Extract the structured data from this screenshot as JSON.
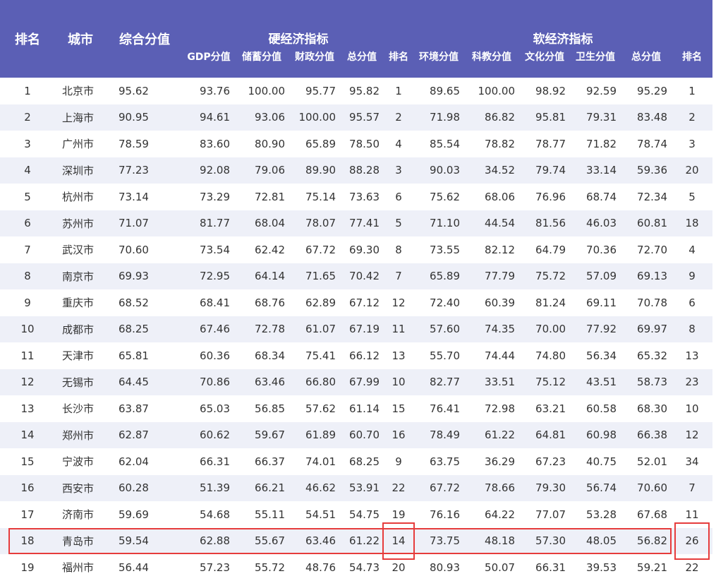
{
  "header": {
    "rank": "排名",
    "city": "城市",
    "composite": "综合分值",
    "hard_group": "硬经济指标",
    "soft_group": "软经济指标",
    "hard_cols": [
      "GDP分值",
      "储蓄分值",
      "财政分值",
      "总分值",
      "排名"
    ],
    "soft_cols": [
      "环境分值",
      "科教分值",
      "文化分值",
      "卫生分值",
      "总分值",
      "排名"
    ]
  },
  "rows": [
    [
      "1",
      "北京市",
      "95.62",
      "93.76",
      "100.00",
      "95.77",
      "95.82",
      "1",
      "89.65",
      "100.00",
      "98.92",
      "92.59",
      "95.29",
      "1"
    ],
    [
      "2",
      "上海市",
      "90.95",
      "94.61",
      "93.06",
      "100.00",
      "95.57",
      "2",
      "71.98",
      "86.82",
      "95.81",
      "79.31",
      "83.48",
      "2"
    ],
    [
      "3",
      "广州市",
      "78.59",
      "83.60",
      "80.90",
      "65.89",
      "78.50",
      "4",
      "85.54",
      "78.82",
      "78.77",
      "71.82",
      "78.74",
      "3"
    ],
    [
      "4",
      "深圳市",
      "77.23",
      "92.08",
      "79.06",
      "89.90",
      "88.28",
      "3",
      "90.03",
      "34.52",
      "79.74",
      "33.14",
      "59.36",
      "20"
    ],
    [
      "5",
      "杭州市",
      "73.14",
      "73.29",
      "72.81",
      "75.14",
      "73.63",
      "6",
      "75.62",
      "68.06",
      "76.96",
      "68.74",
      "72.34",
      "5"
    ],
    [
      "6",
      "苏州市",
      "71.07",
      "81.77",
      "68.04",
      "78.07",
      "77.41",
      "5",
      "71.10",
      "44.54",
      "81.56",
      "46.03",
      "60.81",
      "18"
    ],
    [
      "7",
      "武汉市",
      "70.60",
      "73.54",
      "62.42",
      "67.72",
      "69.30",
      "8",
      "73.55",
      "82.12",
      "64.79",
      "70.36",
      "72.70",
      "4"
    ],
    [
      "8",
      "南京市",
      "69.93",
      "72.95",
      "64.14",
      "71.65",
      "70.42",
      "7",
      "65.89",
      "77.79",
      "75.72",
      "57.09",
      "69.13",
      "9"
    ],
    [
      "9",
      "重庆市",
      "68.52",
      "68.41",
      "68.76",
      "62.89",
      "67.12",
      "12",
      "72.40",
      "60.39",
      "81.24",
      "69.11",
      "70.78",
      "6"
    ],
    [
      "10",
      "成都市",
      "68.25",
      "67.46",
      "72.78",
      "61.07",
      "67.19",
      "11",
      "57.60",
      "74.35",
      "70.00",
      "77.92",
      "69.97",
      "8"
    ],
    [
      "11",
      "天津市",
      "65.81",
      "60.36",
      "68.34",
      "75.41",
      "66.12",
      "13",
      "55.70",
      "74.44",
      "74.80",
      "56.34",
      "65.32",
      "13"
    ],
    [
      "12",
      "无锡市",
      "64.45",
      "70.86",
      "63.46",
      "66.80",
      "67.99",
      "10",
      "82.77",
      "33.51",
      "75.12",
      "43.51",
      "58.73",
      "23"
    ],
    [
      "13",
      "长沙市",
      "63.87",
      "65.03",
      "56.85",
      "57.62",
      "61.14",
      "15",
      "76.41",
      "72.98",
      "63.21",
      "60.58",
      "68.30",
      "10"
    ],
    [
      "14",
      "郑州市",
      "62.87",
      "60.62",
      "59.67",
      "61.89",
      "60.70",
      "16",
      "78.49",
      "61.22",
      "64.81",
      "60.98",
      "66.38",
      "12"
    ],
    [
      "15",
      "宁波市",
      "62.04",
      "66.31",
      "66.37",
      "74.01",
      "68.25",
      "9",
      "63.75",
      "36.29",
      "67.23",
      "40.75",
      "52.01",
      "34"
    ],
    [
      "16",
      "西安市",
      "60.28",
      "51.39",
      "66.21",
      "46.62",
      "53.91",
      "22",
      "67.72",
      "78.66",
      "79.30",
      "56.74",
      "70.60",
      "7"
    ],
    [
      "17",
      "济南市",
      "59.69",
      "54.68",
      "55.11",
      "54.51",
      "54.75",
      "19",
      "76.16",
      "64.22",
      "77.07",
      "53.28",
      "67.68",
      "11"
    ],
    [
      "18",
      "青岛市",
      "59.54",
      "62.88",
      "55.67",
      "63.46",
      "61.22",
      "14",
      "73.75",
      "48.18",
      "57.30",
      "48.05",
      "56.82",
      "26"
    ],
    [
      "19",
      "福州市",
      "56.44",
      "57.23",
      "55.72",
      "48.76",
      "54.73",
      "20",
      "80.93",
      "50.07",
      "66.31",
      "39.53",
      "59.21",
      "22"
    ]
  ],
  "colors": {
    "header_bg": "#5b5fb5",
    "stripe": "#eef0f8",
    "highlight": "#e63c3c"
  }
}
